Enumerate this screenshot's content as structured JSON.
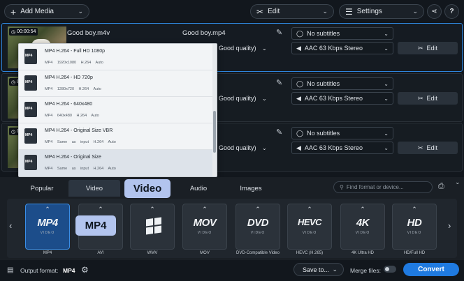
{
  "toolbar": {
    "add_media": "Add Media",
    "edit": "Edit",
    "settings": "Settings",
    "help": "?"
  },
  "files": [
    {
      "duration": "00:00:54",
      "source_name": "Good boy.m4v",
      "output_name": "Good boy.mp4",
      "quality": "Good quality)",
      "subtitles": "No subtitles",
      "audio": "AAC 63 Kbps Stereo",
      "edit_label": "Edit"
    },
    {
      "duration": "0",
      "subtitles": "No subtitles",
      "audio": "AAC 63 Kbps Stereo",
      "quality": "Good quality)",
      "edit_label": "Edit"
    },
    {
      "duration": "0",
      "subtitles": "No subtitles",
      "audio": "AAC 63 Kbps Stereo",
      "quality": "Good quality)",
      "edit_label": "Edit"
    }
  ],
  "dropdown": {
    "options": [
      {
        "name": "MP4 H.264 - Full HD 1080p",
        "container": "MP4",
        "size": "1920x1080",
        "codec": "H.264",
        "audio": "Auto"
      },
      {
        "name": "MP4 H.264 - HD 720p",
        "container": "MP4",
        "size": "1280x720",
        "codec": "H.264",
        "audio": "Auto"
      },
      {
        "name": "MP4 H.264 - 640x480",
        "container": "MP4",
        "size": "640x480",
        "codec": "H.264",
        "audio": "Auto"
      },
      {
        "name": "MP4 H.264 - Original Size VBR",
        "container": "MP4",
        "size": "Same as input",
        "codec": "H.264",
        "audio": "Auto"
      },
      {
        "name": "MP4 H.264 - Original Size",
        "container": "MP4",
        "size": "Same as input",
        "codec": "H.264",
        "audio": "Auto"
      }
    ]
  },
  "tabs": [
    "Popular",
    "Video",
    "Audio",
    "Images"
  ],
  "search_placeholder": "Find format or device...",
  "callouts": {
    "tab": "Video",
    "format": "MP4"
  },
  "formats": [
    {
      "logo": "MP4",
      "sub": "VIDEO",
      "label": "MP4"
    },
    {
      "logo": "",
      "sub": "",
      "label": "AVI"
    },
    {
      "logo": "",
      "sub": "",
      "label": "WMV"
    },
    {
      "logo": "MOV",
      "sub": "VIDEO",
      "label": "MOV"
    },
    {
      "logo": "DVD",
      "sub": "VIDEO",
      "label": "DVD-Compatible Video"
    },
    {
      "logo": "HEVC",
      "sub": "VIDEO",
      "label": "HEVC (H.265)"
    },
    {
      "logo": "4K",
      "sub": "VIDEO",
      "label": "4K Ultra HD"
    },
    {
      "logo": "HD",
      "sub": "VIDEO",
      "label": "HD/Full HD"
    }
  ],
  "bottom": {
    "output_label": "Output format:",
    "output_value": "MP4",
    "save_to": "Save to...",
    "merge": "Merge files:",
    "convert": "Convert"
  },
  "colors": {
    "accent": "#1f7ae0",
    "selection": "#2e86de",
    "callout": "#b2c4ee"
  }
}
